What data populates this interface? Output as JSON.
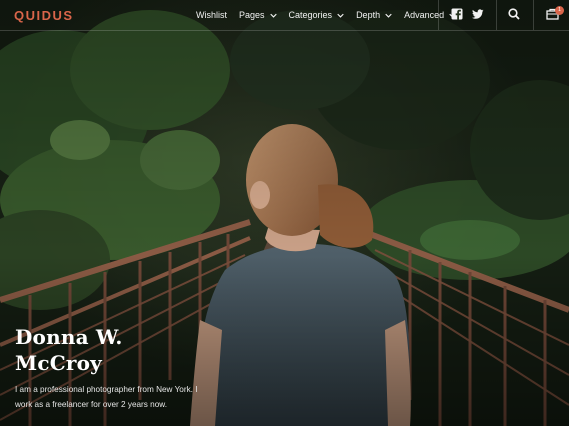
{
  "brand": {
    "logo_text": "QUIDUS",
    "accent_color": "#d9654a"
  },
  "nav": {
    "items": [
      {
        "label": "Wishlist",
        "has_dropdown": false
      },
      {
        "label": "Pages",
        "has_dropdown": true
      },
      {
        "label": "Categories",
        "has_dropdown": true
      },
      {
        "label": "Depth",
        "has_dropdown": true
      },
      {
        "label": "Advanced",
        "has_dropdown": true
      }
    ]
  },
  "actions": {
    "social": [
      "facebook-icon",
      "twitter-icon"
    ],
    "search_icon": "search-icon",
    "cart_icon": "cart-icon",
    "cart_count": "1"
  },
  "hero": {
    "name": "Donna W. McCroy",
    "bio": "I am a professional photographer from New York. I work as a freelancer for over 2 years now."
  }
}
